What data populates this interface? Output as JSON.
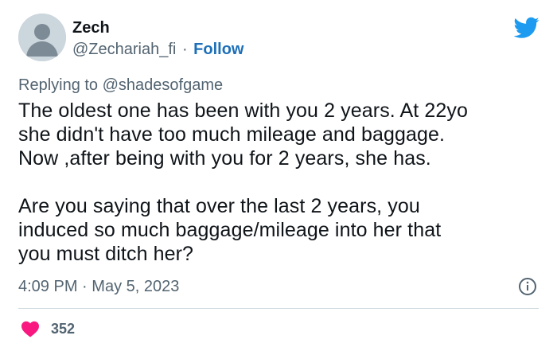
{
  "author": {
    "name": "Zech",
    "handle": "@Zechariah_fi",
    "separator": "·",
    "follow_label": "Follow"
  },
  "reply": {
    "prefix": "Replying to",
    "mention": "@shadesofgame"
  },
  "body": {
    "paragraph1": [
      "The oldest one has been with you 2 years. At 22yo",
      "she didn't have too much mileage and baggage.",
      "Now ,after being with you for 2 years, she has."
    ],
    "paragraph2": [
      "Are you saying that over the last 2 years, you",
      "induced so much baggage/mileage into her that",
      "you must ditch her?"
    ]
  },
  "meta": {
    "time": "4:09 PM",
    "separator": "·",
    "date": "May 5, 2023"
  },
  "engagement": {
    "likes": "352"
  },
  "colors": {
    "brand_blue": "#1d9bf0",
    "follow_blue": "#1d6fb8",
    "like_pink": "#f91880",
    "secondary_text": "#536471"
  },
  "icons": {
    "brand": "twitter-bird-icon",
    "info": "info-icon",
    "like": "heart-icon",
    "avatar": "default-avatar-icon"
  }
}
